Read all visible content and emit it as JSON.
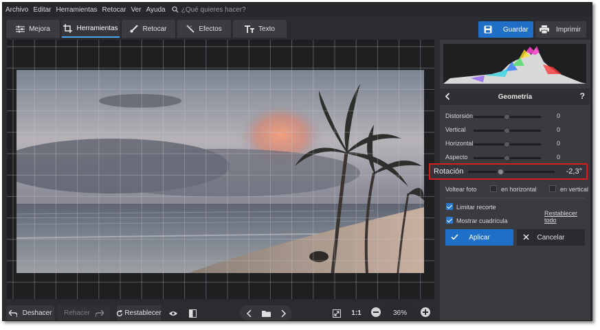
{
  "menu": {
    "items": [
      "Archivo",
      "Editar",
      "Herramientas",
      "Retocar",
      "Ver",
      "Ayuda"
    ],
    "search_placeholder": "¿Qué quieres hacer?"
  },
  "tabs": [
    {
      "label": "Mejora",
      "icon": "sliders-icon"
    },
    {
      "label": "Herramientas",
      "icon": "crop-icon",
      "active": true
    },
    {
      "label": "Retocar",
      "icon": "brush-icon"
    },
    {
      "label": "Efectos",
      "icon": "magic-wand-icon"
    },
    {
      "label": "Texto",
      "icon": "text-icon"
    }
  ],
  "actions": {
    "save_label": "Guardar",
    "print_label": "Imprimir"
  },
  "panel": {
    "title": "Geometría",
    "help": "?",
    "sliders": [
      {
        "label": "Distorsión",
        "value": "0",
        "position": 0.5
      },
      {
        "label": "Vertical",
        "value": "0",
        "position": 0.5
      },
      {
        "label": "Horizontal",
        "value": "0",
        "position": 0.5
      },
      {
        "label": "Aspecto",
        "value": "0",
        "position": 0.5
      }
    ],
    "rotation": {
      "label": "Rotación",
      "value": "-2,3°",
      "position": 0.38
    },
    "flip": {
      "label": "Voltear foto",
      "horizontal": "en horizontal",
      "vertical": "en vertical"
    },
    "limit_crop": {
      "label": "Limitar recorte",
      "checked": true
    },
    "show_grid": {
      "label": "Mostrar cuadrícula",
      "checked": true
    },
    "reset_all": "Restablecer todo",
    "apply": "Aplicar",
    "cancel": "Cancelar"
  },
  "bottom": {
    "undo": "Deshacer",
    "redo": "Rehacer",
    "reset": "Restablecer",
    "zoom_fit": "1:1",
    "zoom_level": "36%"
  },
  "colors": {
    "accent": "#1f6fc6",
    "highlight": "#d61c1c",
    "background": "#2b2c2f",
    "panel": "#3a3b3f"
  }
}
